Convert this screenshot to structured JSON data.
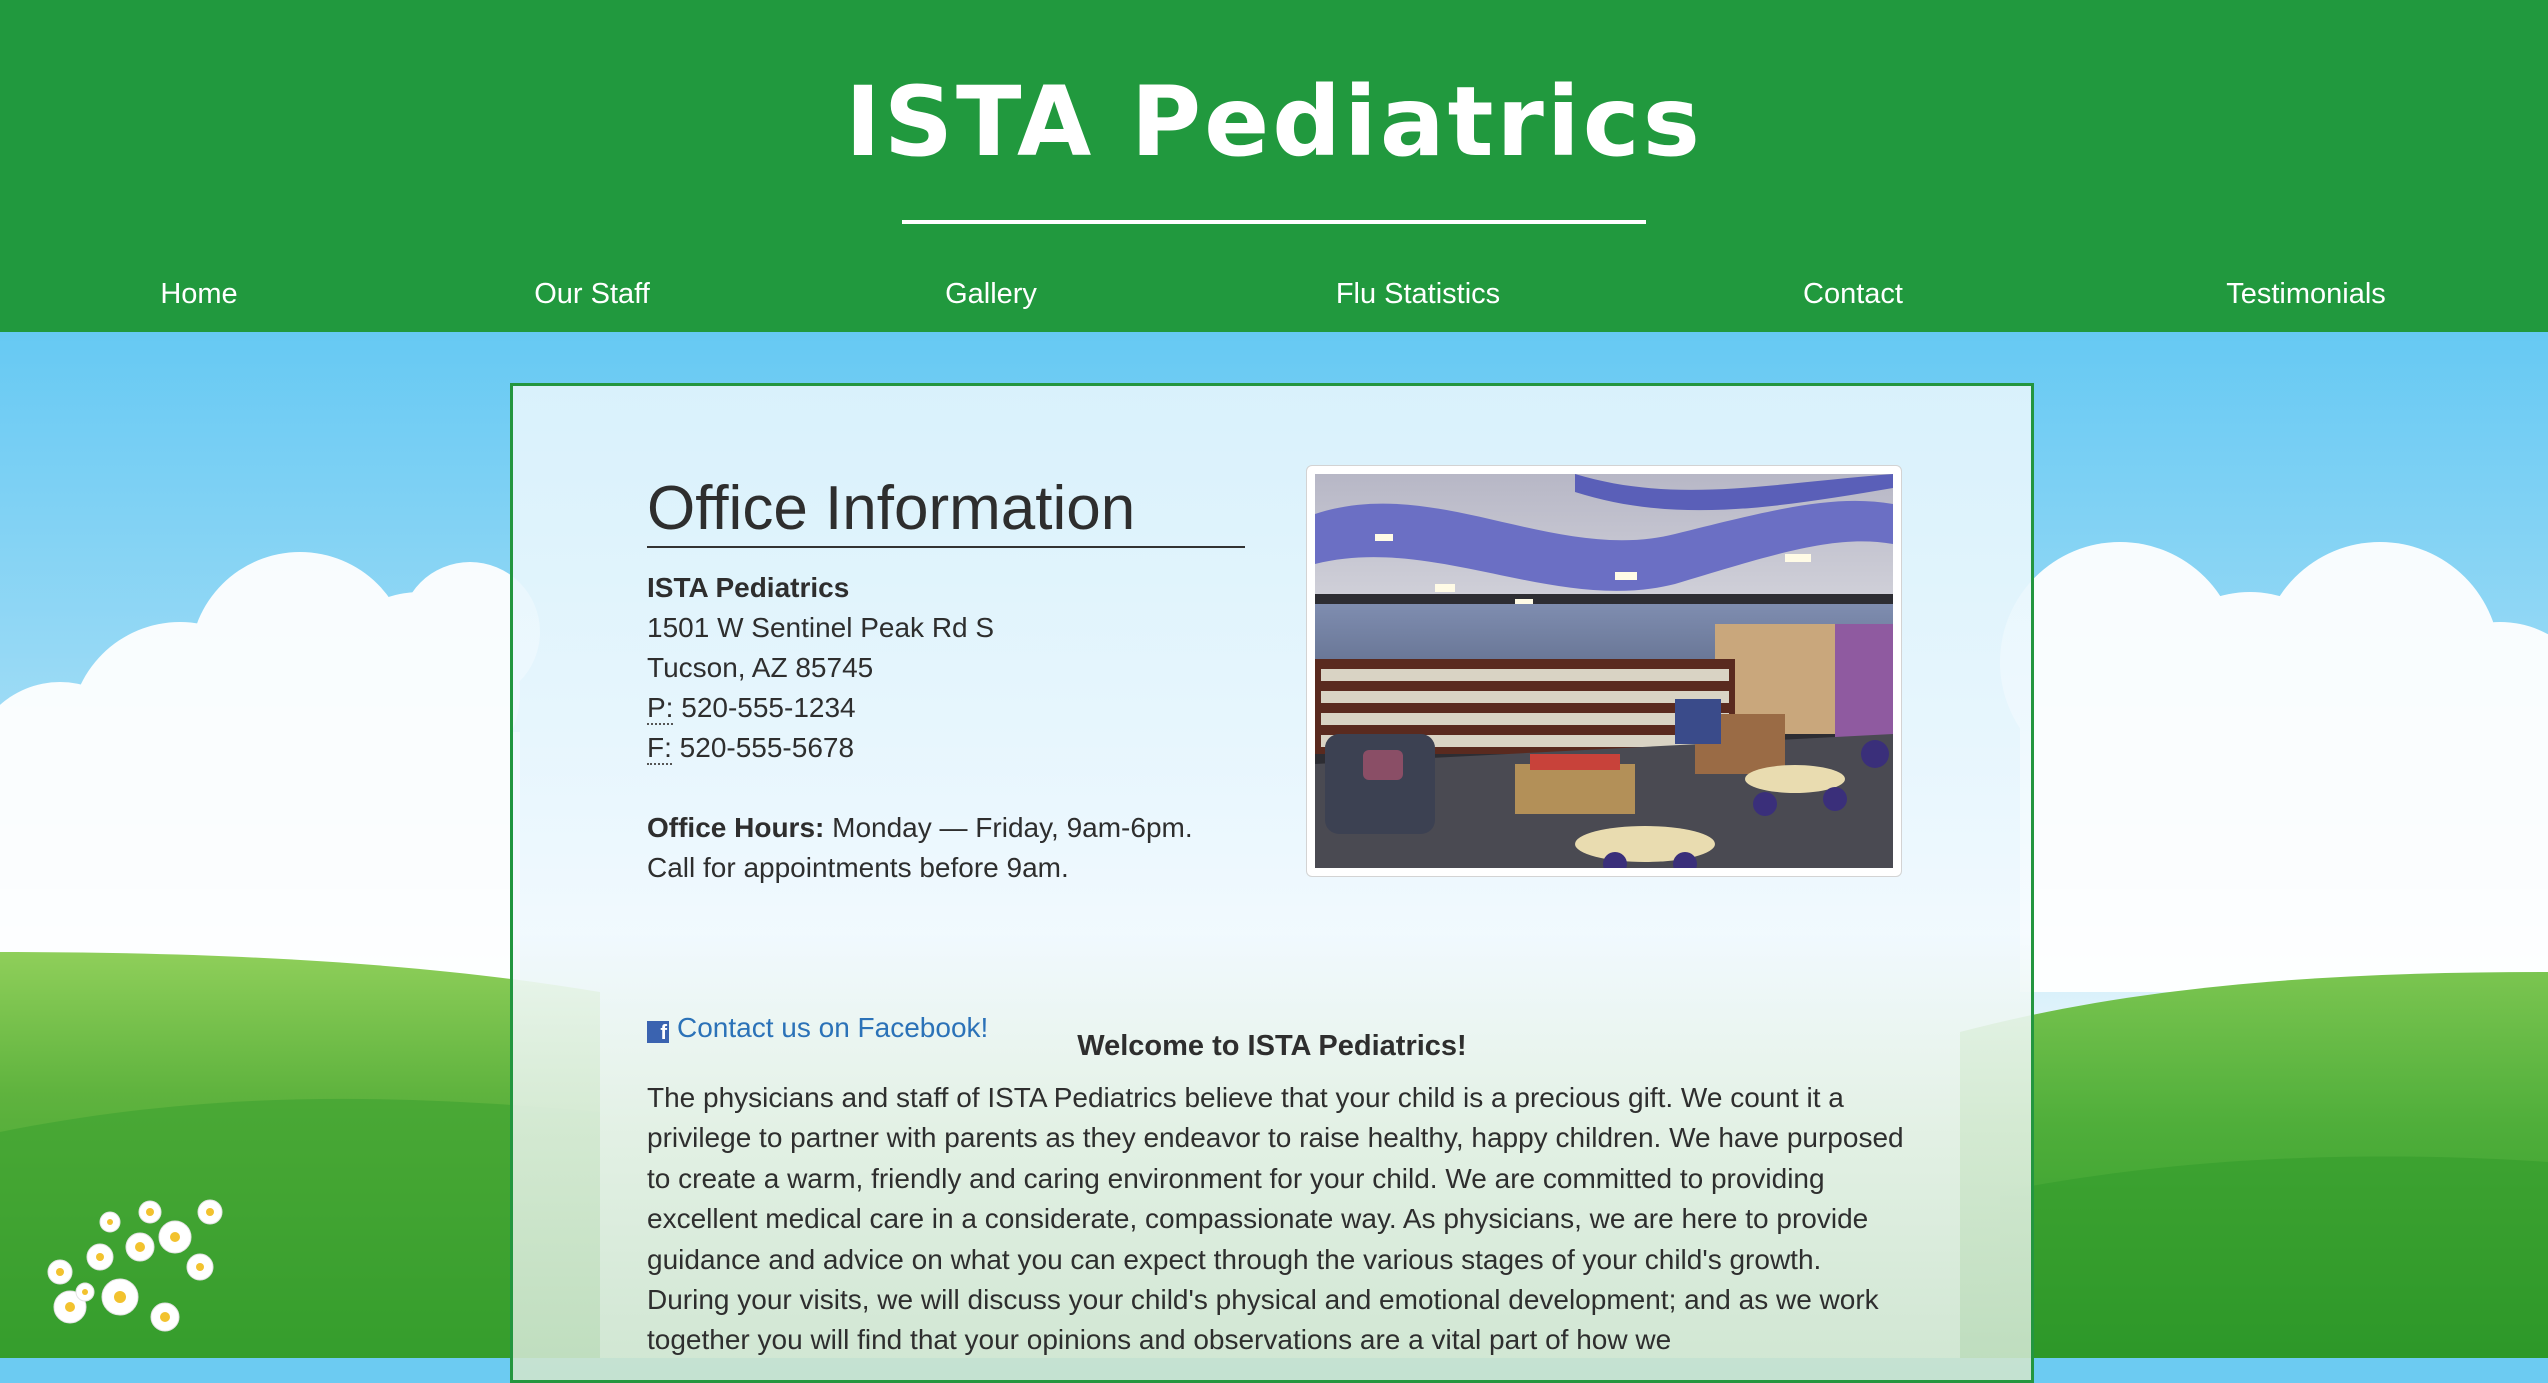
{
  "header": {
    "brand": "ISTA Pediatrics",
    "nav": [
      {
        "label": "Home"
      },
      {
        "label": "Our Staff"
      },
      {
        "label": "Gallery"
      },
      {
        "label": "Flu Statistics"
      },
      {
        "label": "Contact"
      },
      {
        "label": "Testimonials"
      }
    ]
  },
  "office": {
    "title": "Office Information",
    "name": "ISTA Pediatrics",
    "street": "1501 W Sentinel Peak Rd S",
    "city": "Tucson, AZ 85745",
    "phone_label": "P:",
    "phone": " 520-555-1234",
    "fax_label": "F:",
    "fax": " 520-555-5678",
    "hours_label": "Office Hours:",
    "hours": " Monday — Friday, 9am-6pm.",
    "appointments_note": "Call for appointments before 9am.",
    "facebook_icon": "facebook-icon",
    "facebook_link": "Contact us on Facebook!"
  },
  "welcome": {
    "title": "Welcome to ISTA Pediatrics!",
    "body": "The physicians and staff of ISTA Pediatrics believe that your child is a precious gift. We count it a privilege to partner with parents as they endeavor to raise healthy, happy children. We have purposed to create a warm, friendly and caring environment for your child. We are committed to providing excellent medical care in a considerate, compassionate way. As physicians, we are here to provide guidance and advice on what you can expect through the various stages of your child's growth. During your visits, we will discuss your child's physical and emotional development; and as we work together you will find that your opinions and observations are a vital part of how we"
  },
  "colors": {
    "header_green": "#21993e",
    "sky_blue": "#6ccbf2",
    "link_blue": "#2b72b8",
    "text": "#2e2e2e"
  }
}
